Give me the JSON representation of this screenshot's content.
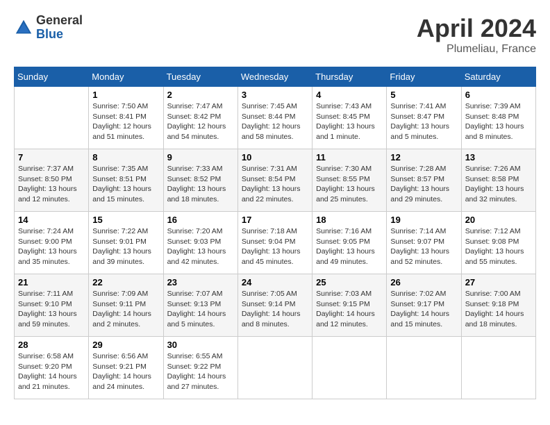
{
  "header": {
    "logo_general": "General",
    "logo_blue": "Blue",
    "month_title": "April 2024",
    "location": "Plumeliau, France"
  },
  "days_of_week": [
    "Sunday",
    "Monday",
    "Tuesday",
    "Wednesday",
    "Thursday",
    "Friday",
    "Saturday"
  ],
  "weeks": [
    [
      {
        "day": "",
        "content": ""
      },
      {
        "day": "1",
        "content": "Sunrise: 7:50 AM\nSunset: 8:41 PM\nDaylight: 12 hours\nand 51 minutes."
      },
      {
        "day": "2",
        "content": "Sunrise: 7:47 AM\nSunset: 8:42 PM\nDaylight: 12 hours\nand 54 minutes."
      },
      {
        "day": "3",
        "content": "Sunrise: 7:45 AM\nSunset: 8:44 PM\nDaylight: 12 hours\nand 58 minutes."
      },
      {
        "day": "4",
        "content": "Sunrise: 7:43 AM\nSunset: 8:45 PM\nDaylight: 13 hours\nand 1 minute."
      },
      {
        "day": "5",
        "content": "Sunrise: 7:41 AM\nSunset: 8:47 PM\nDaylight: 13 hours\nand 5 minutes."
      },
      {
        "day": "6",
        "content": "Sunrise: 7:39 AM\nSunset: 8:48 PM\nDaylight: 13 hours\nand 8 minutes."
      }
    ],
    [
      {
        "day": "7",
        "content": "Sunrise: 7:37 AM\nSunset: 8:50 PM\nDaylight: 13 hours\nand 12 minutes."
      },
      {
        "day": "8",
        "content": "Sunrise: 7:35 AM\nSunset: 8:51 PM\nDaylight: 13 hours\nand 15 minutes."
      },
      {
        "day": "9",
        "content": "Sunrise: 7:33 AM\nSunset: 8:52 PM\nDaylight: 13 hours\nand 18 minutes."
      },
      {
        "day": "10",
        "content": "Sunrise: 7:31 AM\nSunset: 8:54 PM\nDaylight: 13 hours\nand 22 minutes."
      },
      {
        "day": "11",
        "content": "Sunrise: 7:30 AM\nSunset: 8:55 PM\nDaylight: 13 hours\nand 25 minutes."
      },
      {
        "day": "12",
        "content": "Sunrise: 7:28 AM\nSunset: 8:57 PM\nDaylight: 13 hours\nand 29 minutes."
      },
      {
        "day": "13",
        "content": "Sunrise: 7:26 AM\nSunset: 8:58 PM\nDaylight: 13 hours\nand 32 minutes."
      }
    ],
    [
      {
        "day": "14",
        "content": "Sunrise: 7:24 AM\nSunset: 9:00 PM\nDaylight: 13 hours\nand 35 minutes."
      },
      {
        "day": "15",
        "content": "Sunrise: 7:22 AM\nSunset: 9:01 PM\nDaylight: 13 hours\nand 39 minutes."
      },
      {
        "day": "16",
        "content": "Sunrise: 7:20 AM\nSunset: 9:03 PM\nDaylight: 13 hours\nand 42 minutes."
      },
      {
        "day": "17",
        "content": "Sunrise: 7:18 AM\nSunset: 9:04 PM\nDaylight: 13 hours\nand 45 minutes."
      },
      {
        "day": "18",
        "content": "Sunrise: 7:16 AM\nSunset: 9:05 PM\nDaylight: 13 hours\nand 49 minutes."
      },
      {
        "day": "19",
        "content": "Sunrise: 7:14 AM\nSunset: 9:07 PM\nDaylight: 13 hours\nand 52 minutes."
      },
      {
        "day": "20",
        "content": "Sunrise: 7:12 AM\nSunset: 9:08 PM\nDaylight: 13 hours\nand 55 minutes."
      }
    ],
    [
      {
        "day": "21",
        "content": "Sunrise: 7:11 AM\nSunset: 9:10 PM\nDaylight: 13 hours\nand 59 minutes."
      },
      {
        "day": "22",
        "content": "Sunrise: 7:09 AM\nSunset: 9:11 PM\nDaylight: 14 hours\nand 2 minutes."
      },
      {
        "day": "23",
        "content": "Sunrise: 7:07 AM\nSunset: 9:13 PM\nDaylight: 14 hours\nand 5 minutes."
      },
      {
        "day": "24",
        "content": "Sunrise: 7:05 AM\nSunset: 9:14 PM\nDaylight: 14 hours\nand 8 minutes."
      },
      {
        "day": "25",
        "content": "Sunrise: 7:03 AM\nSunset: 9:15 PM\nDaylight: 14 hours\nand 12 minutes."
      },
      {
        "day": "26",
        "content": "Sunrise: 7:02 AM\nSunset: 9:17 PM\nDaylight: 14 hours\nand 15 minutes."
      },
      {
        "day": "27",
        "content": "Sunrise: 7:00 AM\nSunset: 9:18 PM\nDaylight: 14 hours\nand 18 minutes."
      }
    ],
    [
      {
        "day": "28",
        "content": "Sunrise: 6:58 AM\nSunset: 9:20 PM\nDaylight: 14 hours\nand 21 minutes."
      },
      {
        "day": "29",
        "content": "Sunrise: 6:56 AM\nSunset: 9:21 PM\nDaylight: 14 hours\nand 24 minutes."
      },
      {
        "day": "30",
        "content": "Sunrise: 6:55 AM\nSunset: 9:22 PM\nDaylight: 14 hours\nand 27 minutes."
      },
      {
        "day": "",
        "content": ""
      },
      {
        "day": "",
        "content": ""
      },
      {
        "day": "",
        "content": ""
      },
      {
        "day": "",
        "content": ""
      }
    ]
  ]
}
